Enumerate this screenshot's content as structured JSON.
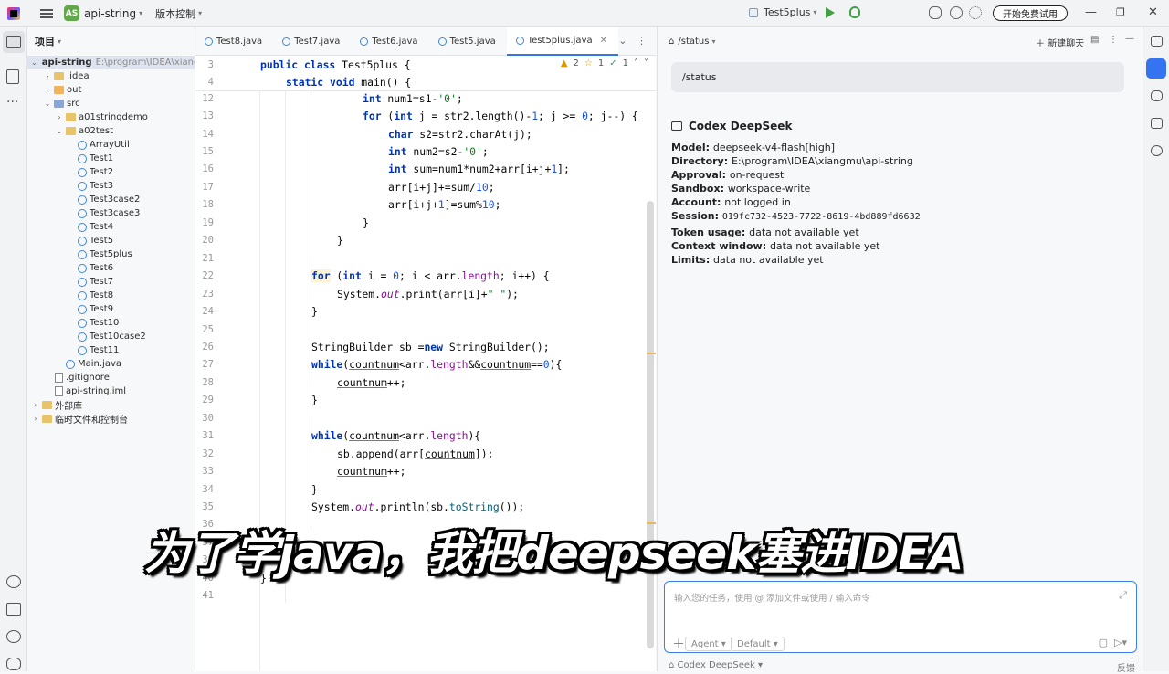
{
  "titlebar": {
    "project_badge": "AS",
    "project_name": "api-string",
    "vcs": "版本控制",
    "run_config": "Test5plus",
    "trial_button": "开始免费试用"
  },
  "project_panel": {
    "title": "项目",
    "tree": [
      {
        "label": "api-string",
        "suffix": "E:\\program\\IDEA\\xiangm",
        "kind": "folder",
        "indent": 0,
        "twisty": "v",
        "selected": true
      },
      {
        "label": ".idea",
        "kind": "folder",
        "indent": 1,
        "twisty": ">"
      },
      {
        "label": "out",
        "kind": "folder-out",
        "indent": 1,
        "twisty": ">"
      },
      {
        "label": "src",
        "kind": "folder-src",
        "indent": 1,
        "twisty": "v"
      },
      {
        "label": "a01stringdemo",
        "kind": "folder",
        "indent": 2,
        "twisty": ">"
      },
      {
        "label": "a02test",
        "kind": "folder",
        "indent": 2,
        "twisty": "v"
      },
      {
        "label": "ArrayUtil",
        "kind": "java",
        "indent": 3
      },
      {
        "label": "Test1",
        "kind": "java",
        "indent": 3
      },
      {
        "label": "Test2",
        "kind": "java",
        "indent": 3
      },
      {
        "label": "Test3",
        "kind": "java",
        "indent": 3
      },
      {
        "label": "Test3case2",
        "kind": "java",
        "indent": 3
      },
      {
        "label": "Test3case3",
        "kind": "java",
        "indent": 3
      },
      {
        "label": "Test4",
        "kind": "java",
        "indent": 3
      },
      {
        "label": "Test5",
        "kind": "java",
        "indent": 3
      },
      {
        "label": "Test5plus",
        "kind": "java",
        "indent": 3
      },
      {
        "label": "Test6",
        "kind": "java",
        "indent": 3
      },
      {
        "label": "Test7",
        "kind": "java",
        "indent": 3
      },
      {
        "label": "Test8",
        "kind": "java",
        "indent": 3
      },
      {
        "label": "Test9",
        "kind": "java",
        "indent": 3
      },
      {
        "label": "Test10",
        "kind": "java",
        "indent": 3
      },
      {
        "label": "Test10case2",
        "kind": "java",
        "indent": 3
      },
      {
        "label": "Test11",
        "kind": "java",
        "indent": 3
      },
      {
        "label": "Main.java",
        "kind": "java",
        "indent": 2
      },
      {
        "label": ".gitignore",
        "kind": "plain",
        "indent": 1
      },
      {
        "label": "api-string.iml",
        "kind": "plain",
        "indent": 1
      },
      {
        "label": "外部库",
        "kind": "folder",
        "indent": 0,
        "twisty": ">"
      },
      {
        "label": "临时文件和控制台",
        "kind": "folder",
        "indent": 0,
        "twisty": ">"
      }
    ]
  },
  "tabs": [
    {
      "label": "Test8.java",
      "active": false
    },
    {
      "label": "Test7.java",
      "active": false
    },
    {
      "label": "Test6.java",
      "active": false
    },
    {
      "label": "Test5.java",
      "active": false
    },
    {
      "label": "Test5plus.java",
      "active": true
    }
  ],
  "inspections": {
    "warnings": "2",
    "weak": "1",
    "ok": "1"
  },
  "editor": {
    "sticky": [
      {
        "ln": "3",
        "html": "<span class=\"kw\">public class</span> Test5plus {",
        "indent": 0
      },
      {
        "ln": "4",
        "html": "<span class=\"kw\">static void</span> main() {",
        "indent": 1
      }
    ],
    "lines": [
      {
        "ln": "12",
        "indent": 4,
        "html": "<span class=\"kw\">int</span> num1=s1-<span class=\"str\">'0'</span>;"
      },
      {
        "ln": "13",
        "indent": 4,
        "html": "<span class=\"kw\">for</span> (<span class=\"kw\">int</span> j = str2.length()-<span class=\"num\">1</span>; j &gt;= <span class=\"num\">0</span>; j--) {"
      },
      {
        "ln": "14",
        "indent": 5,
        "html": "<span class=\"kw\">char</span> s2=str2.charAt(j);"
      },
      {
        "ln": "15",
        "indent": 5,
        "html": "<span class=\"kw\">int</span> num2=s2-<span class=\"str\">'0'</span>;"
      },
      {
        "ln": "16",
        "indent": 5,
        "html": "<span class=\"kw\">int</span> sum=num1*num2+arr[i+j+<span class=\"num\">1</span>];"
      },
      {
        "ln": "17",
        "indent": 5,
        "html": "arr[i+j]+=sum/<span class=\"num\">10</span>;"
      },
      {
        "ln": "18",
        "indent": 5,
        "html": "arr[i+j+<span class=\"num\">1</span>]=sum%<span class=\"num\">10</span>;"
      },
      {
        "ln": "19",
        "indent": 4,
        "html": "}"
      },
      {
        "ln": "20",
        "indent": 3,
        "html": "}"
      },
      {
        "ln": "21",
        "indent": 0,
        "html": ""
      },
      {
        "ln": "22",
        "indent": 2,
        "html": "<span class=\"kw hl\">for</span> (<span class=\"kw\">int</span> i = <span class=\"num\">0</span>; i &lt; arr.<span class=\"fld\">length</span>; i++) {"
      },
      {
        "ln": "23",
        "indent": 3,
        "html": "System.<span class=\"fld ital\">out</span>.print(arr[i]+<span class=\"str\">\" \"</span>);"
      },
      {
        "ln": "24",
        "indent": 2,
        "html": "}"
      },
      {
        "ln": "25",
        "indent": 0,
        "html": ""
      },
      {
        "ln": "26",
        "indent": 2,
        "html": "StringBuilder sb =<span class=\"kw\">new</span> StringBuilder();"
      },
      {
        "ln": "27",
        "indent": 2,
        "html": "<span class=\"kw\">while</span>(<span class=\"ul\">countnum</span>&lt;arr.<span class=\"fld\">length</span>&amp;&amp;<span class=\"ul\">countnum</span>==<span class=\"num\">0</span>){"
      },
      {
        "ln": "28",
        "indent": 3,
        "html": "<span class=\"ul\">countnum</span>++;"
      },
      {
        "ln": "29",
        "indent": 2,
        "html": "}"
      },
      {
        "ln": "30",
        "indent": 0,
        "html": ""
      },
      {
        "ln": "31",
        "indent": 2,
        "html": "<span class=\"kw\">while</span>(<span class=\"ul\">countnum</span>&lt;arr.<span class=\"fld\">length</span>){"
      },
      {
        "ln": "32",
        "indent": 3,
        "html": "sb.append(arr[<span class=\"ul\">countnum</span>]);"
      },
      {
        "ln": "33",
        "indent": 3,
        "html": "<span class=\"ul\">countnum</span>++;"
      },
      {
        "ln": "34",
        "indent": 2,
        "html": "}"
      },
      {
        "ln": "35",
        "indent": 2,
        "html": "System.<span class=\"fld ital\">out</span>.println(sb.<span class=\"mth\">toString</span>());"
      },
      {
        "ln": "36",
        "indent": 0,
        "html": ""
      },
      {
        "ln": "37",
        "indent": 0,
        "html": ""
      },
      {
        "ln": "39",
        "indent": 0,
        "html": ""
      },
      {
        "ln": "40",
        "indent": 0,
        "html": "}"
      },
      {
        "ln": "41",
        "indent": 0,
        "html": ""
      }
    ]
  },
  "ai_panel": {
    "header": "/status",
    "new_chat": "新建聊天",
    "command": "/status",
    "title": "Codex DeepSeek",
    "rows": [
      {
        "key": "Model:",
        "value": "deepseek-v4-flash[high]",
        "mono": false
      },
      {
        "key": "Directory:",
        "value": "E:\\program\\IDEA\\xiangmu\\api-string",
        "mono": false
      },
      {
        "key": "Approval:",
        "value": "on-request",
        "mono": false
      },
      {
        "key": "Sandbox:",
        "value": "workspace-write",
        "mono": false
      },
      {
        "key": "Account:",
        "value": "not logged in",
        "mono": false
      },
      {
        "key": "Session:",
        "value": "019fc732-4523-7722-8619-4bd889fd6632",
        "mono": true
      },
      {
        "key": "Token usage:",
        "value": "data not available yet",
        "mono": false
      },
      {
        "key": "Context window:",
        "value": "data not available yet",
        "mono": false
      },
      {
        "key": "Limits:",
        "value": "data not available yet",
        "mono": false
      }
    ],
    "input_placeholder": "输入您的任务，使用 @ 添加文件或使用 / 输入命令",
    "mode": "Agent",
    "model": "Default",
    "footer": "Codex DeepSeek",
    "footer_right": "反馈"
  },
  "subtitle": "为了学java，我把deepseek塞进IDEA",
  "colors": {
    "accent": "#3574f0",
    "keyword": "#0033b3",
    "string": "#067d17",
    "number": "#1750eb"
  }
}
